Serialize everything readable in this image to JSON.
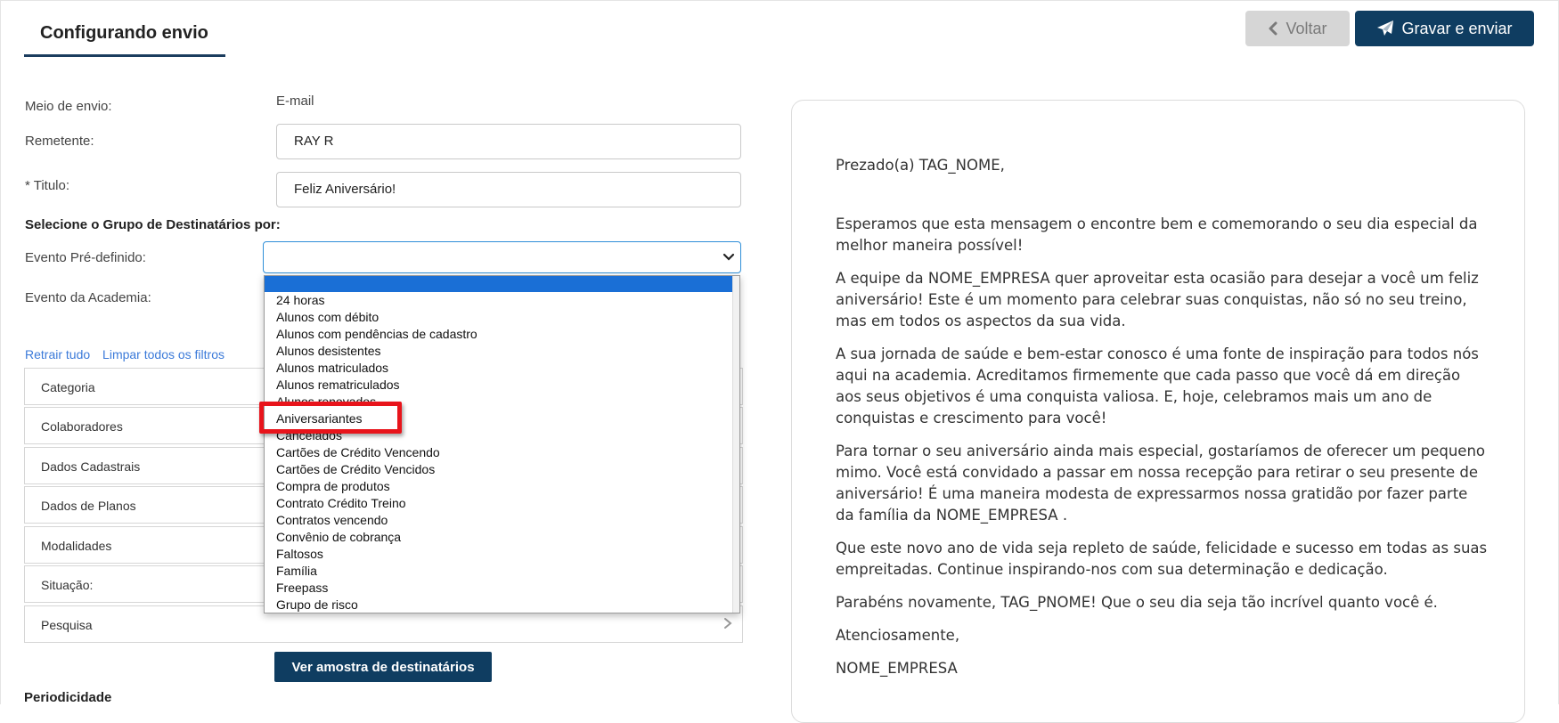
{
  "header": {
    "title": "Configurando envio",
    "back_label": "Voltar",
    "send_label": "Gravar e enviar"
  },
  "form": {
    "meio_label": "Meio de envio:",
    "meio_value": "E-mail",
    "remetente_label": "Remetente:",
    "remetente_value": "RAY R",
    "titulo_label": "* Titulo:",
    "titulo_value": "Feliz Aniversário!",
    "grupo_heading": "Selecione o Grupo de Destinatários por:",
    "evento_predef_label": "Evento Pré-definido:",
    "evento_predef_value": "",
    "evento_academia_label": "Evento da Academia:"
  },
  "filters": {
    "retrair": "Retrair tudo",
    "limpar": "Limpar todos os filtros",
    "sections": [
      "Categoria",
      "Colaboradores",
      "Dados Cadastrais",
      "Dados de Planos",
      "Modalidades",
      "Situação:",
      "Pesquisa"
    ]
  },
  "sample_button": "Ver amostra de destinatários",
  "periodicidade": "Periodicidade",
  "dropdown": {
    "options": [
      "24 horas",
      "Alunos com débito",
      "Alunos com pendências de cadastro",
      "Alunos desistentes",
      "Alunos matriculados",
      "Alunos rematriculados",
      "Alunos renovados",
      "Aniversariantes",
      "Cancelados",
      "Cartões de Crédito Vencendo",
      "Cartões de Crédito Vencidos",
      "Compra de produtos",
      "Contrato Crédito Treino",
      "Contratos vencendo",
      "Convênio de cobrança",
      "Faltosos",
      "Família",
      "Freepass",
      "Grupo de risco"
    ],
    "highlighted_option": "Aniversariantes"
  },
  "preview": {
    "greeting": "Prezado(a) TAG_NOME,",
    "paragraphs": [
      "Esperamos que esta mensagem o encontre bem e comemorando o seu dia especial da melhor maneira possível!",
      "A equipe da NOME_EMPRESA  quer aproveitar esta ocasião para desejar a você um feliz aniversário! Este é um momento para celebrar suas conquistas, não só no seu treino, mas em todos os aspectos da sua vida.",
      "A sua jornada de saúde e bem-estar conosco é uma fonte de inspiração para todos nós aqui na academia. Acreditamos firmemente que cada passo que você dá em direção aos seus objetivos é uma conquista valiosa. E, hoje, celebramos mais um ano de conquistas e crescimento para você!",
      "Para tornar o seu aniversário ainda mais especial, gostaríamos de oferecer um pequeno mimo. Você está convidado a passar em nossa recepção para retirar o seu presente de aniversário! É uma maneira modesta de expressarmos nossa gratidão por fazer parte da família da NOME_EMPRESA .",
      "Que este novo ano de vida seja repleto de saúde, felicidade e sucesso em todas as suas empreitadas. Continue inspirando-nos com sua determinação e dedicação.",
      "Parabéns novamente, TAG_PNOME! Que o seu dia seja tão incrível quanto você é.",
      "Atenciosamente,",
      "NOME_EMPRESA"
    ]
  },
  "colors": {
    "primary": "#0f3d61",
    "back_button": "#d6d6d6",
    "highlight": "#1a6fd6",
    "annotation": "#e8141b",
    "link": "#3b7ad9"
  }
}
